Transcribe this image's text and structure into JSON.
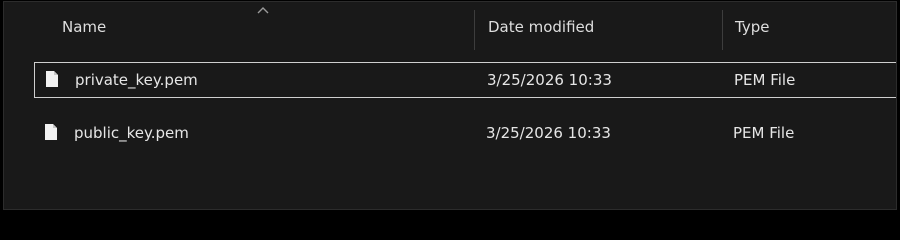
{
  "columns": {
    "name": "Name",
    "date_modified": "Date modified",
    "type": "Type"
  },
  "sort": {
    "column": "Name",
    "direction": "ascending"
  },
  "files": [
    {
      "name": "private_key.pem",
      "date_modified": "3/25/2026 10:33",
      "type": "PEM File",
      "selected": true,
      "icon": "file-icon"
    },
    {
      "name": "public_key.pem",
      "date_modified": "3/25/2026 10:33",
      "type": "PEM File",
      "selected": false,
      "icon": "file-icon"
    }
  ],
  "colors": {
    "background": "#191919",
    "text": "#e6e6e6",
    "selection_border": "#cfcfcf"
  }
}
